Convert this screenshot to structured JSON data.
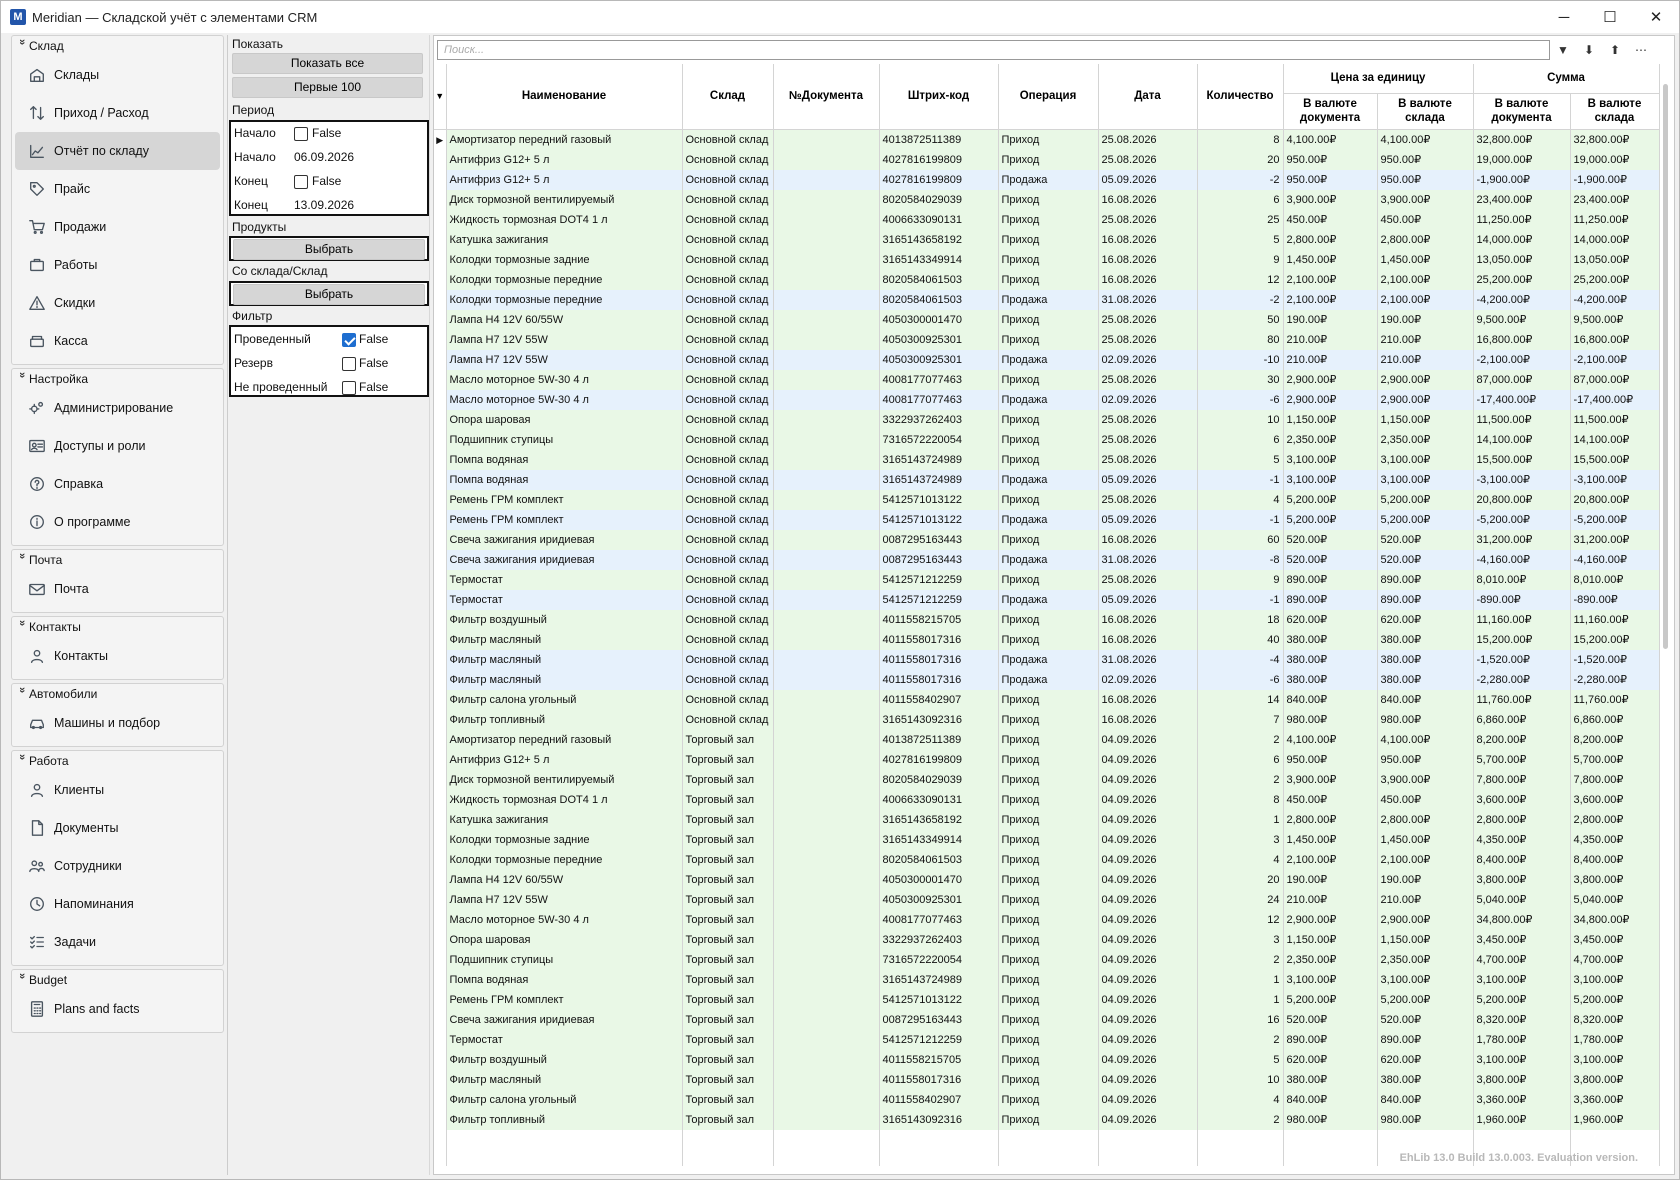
{
  "window": {
    "title": "Meridian — Складской учёт с элементами CRM",
    "logo": "M",
    "minimize": "─",
    "maximize": "☐",
    "close": "✕"
  },
  "sidebar": {
    "groups": [
      {
        "title": "Склад",
        "items": [
          {
            "label": "Склады",
            "icon": "warehouse-icon"
          },
          {
            "label": "Приход / Расход",
            "icon": "in-out-icon"
          },
          {
            "label": "Отчёт по складу",
            "icon": "report-chart-icon",
            "active": true
          },
          {
            "label": "Прайс",
            "icon": "tag-icon"
          },
          {
            "label": "Продажи",
            "icon": "cart-icon"
          },
          {
            "label": "Работы",
            "icon": "briefcase-icon"
          },
          {
            "label": "Скидки",
            "icon": "warning-icon"
          },
          {
            "label": "Касса",
            "icon": "cashbox-icon"
          }
        ]
      },
      {
        "title": "Настройка",
        "items": [
          {
            "label": "Администрирование",
            "icon": "gears-icon"
          },
          {
            "label": "Доступы и роли",
            "icon": "id-card-icon"
          },
          {
            "label": "Справка",
            "icon": "help-icon"
          },
          {
            "label": "О программе",
            "icon": "info-icon"
          }
        ]
      },
      {
        "title": "Почта",
        "items": [
          {
            "label": "Почта",
            "icon": "mail-icon"
          }
        ]
      },
      {
        "title": "Контакты",
        "items": [
          {
            "label": "Контакты",
            "icon": "person-icon"
          }
        ]
      },
      {
        "title": "Автомобили",
        "items": [
          {
            "label": "Машины и подбор",
            "icon": "car-icon"
          }
        ]
      },
      {
        "title": "Работа",
        "items": [
          {
            "label": "Клиенты",
            "icon": "person-icon"
          },
          {
            "label": "Документы",
            "icon": "document-icon"
          },
          {
            "label": "Сотрудники",
            "icon": "people-icon"
          },
          {
            "label": "Напоминания",
            "icon": "clock-icon"
          },
          {
            "label": "Задачи",
            "icon": "checklist-icon"
          }
        ]
      },
      {
        "title": "Budget",
        "items": [
          {
            "label": "Plans and facts",
            "icon": "calculator-icon"
          }
        ]
      }
    ]
  },
  "filter": {
    "show_label": "Показать",
    "show_all": "Показать все",
    "first_100": "Первые 100",
    "period_label": "Период",
    "start1_label": "Начало",
    "start1_value": "False",
    "start2_label": "Начало",
    "start2_value": "06.09.2026",
    "end1_label": "Конец",
    "end1_value": "False",
    "end2_label": "Конец",
    "end2_value": "13.09.2026",
    "products_label": "Продукты",
    "products_btn": "Выбрать",
    "from_wh_label": "Со склада/Склад",
    "from_wh_btn": "Выбрать",
    "filter_label": "Фильтр",
    "posted_label": "Проведенный",
    "posted_value": "False",
    "reserve_label": "Резерв",
    "reserve_value": "False",
    "notposted_label": "Не проведенный",
    "notposted_value": "False"
  },
  "grid": {
    "search_placeholder": "Поиск...",
    "headers": {
      "name": "Наименование",
      "wh": "Склад",
      "doc": "№Документа",
      "barcode": "Штрих-код",
      "op": "Операция",
      "date": "Дата",
      "qty": "Количество",
      "unit_price": "Цена за единицу",
      "sum": "Сумма",
      "doc_cur": "В валюте документа",
      "wh_cur": "В валюте склада"
    },
    "rows": [
      [
        "Амортизатор передний газовый",
        "Основной склад",
        "",
        "4013872511389",
        "Приход",
        "25.08.2026",
        "8",
        "4,100.00₽",
        "4,100.00₽",
        "32,800.00₽",
        "32,800.00₽"
      ],
      [
        "Антифриз G12+ 5 л",
        "Основной склад",
        "",
        "4027816199809",
        "Приход",
        "25.08.2026",
        "20",
        "950.00₽",
        "950.00₽",
        "19,000.00₽",
        "19,000.00₽"
      ],
      [
        "Антифриз G12+ 5 л",
        "Основной склад",
        "",
        "4027816199809",
        "Продажа",
        "05.09.2026",
        "-2",
        "950.00₽",
        "950.00₽",
        "-1,900.00₽",
        "-1,900.00₽"
      ],
      [
        "Диск тормозной вентилируемый",
        "Основной склад",
        "",
        "8020584029039",
        "Приход",
        "16.08.2026",
        "6",
        "3,900.00₽",
        "3,900.00₽",
        "23,400.00₽",
        "23,400.00₽"
      ],
      [
        "Жидкость тормозная DOT4 1 л",
        "Основной склад",
        "",
        "4006633090131",
        "Приход",
        "25.08.2026",
        "25",
        "450.00₽",
        "450.00₽",
        "11,250.00₽",
        "11,250.00₽"
      ],
      [
        "Катушка зажигания",
        "Основной склад",
        "",
        "3165143658192",
        "Приход",
        "16.08.2026",
        "5",
        "2,800.00₽",
        "2,800.00₽",
        "14,000.00₽",
        "14,000.00₽"
      ],
      [
        "Колодки тормозные задние",
        "Основной склад",
        "",
        "3165143349914",
        "Приход",
        "16.08.2026",
        "9",
        "1,450.00₽",
        "1,450.00₽",
        "13,050.00₽",
        "13,050.00₽"
      ],
      [
        "Колодки тормозные передние",
        "Основной склад",
        "",
        "8020584061503",
        "Приход",
        "16.08.2026",
        "12",
        "2,100.00₽",
        "2,100.00₽",
        "25,200.00₽",
        "25,200.00₽"
      ],
      [
        "Колодки тормозные передние",
        "Основной склад",
        "",
        "8020584061503",
        "Продажа",
        "31.08.2026",
        "-2",
        "2,100.00₽",
        "2,100.00₽",
        "-4,200.00₽",
        "-4,200.00₽"
      ],
      [
        "Лампа H4 12V 60/55W",
        "Основной склад",
        "",
        "4050300001470",
        "Приход",
        "25.08.2026",
        "50",
        "190.00₽",
        "190.00₽",
        "9,500.00₽",
        "9,500.00₽"
      ],
      [
        "Лампа H7 12V 55W",
        "Основной склад",
        "",
        "4050300925301",
        "Приход",
        "25.08.2026",
        "80",
        "210.00₽",
        "210.00₽",
        "16,800.00₽",
        "16,800.00₽"
      ],
      [
        "Лампа H7 12V 55W",
        "Основной склад",
        "",
        "4050300925301",
        "Продажа",
        "02.09.2026",
        "-10",
        "210.00₽",
        "210.00₽",
        "-2,100.00₽",
        "-2,100.00₽"
      ],
      [
        "Масло моторное 5W-30 4 л",
        "Основной склад",
        "",
        "4008177077463",
        "Приход",
        "25.08.2026",
        "30",
        "2,900.00₽",
        "2,900.00₽",
        "87,000.00₽",
        "87,000.00₽"
      ],
      [
        "Масло моторное 5W-30 4 л",
        "Основной склад",
        "",
        "4008177077463",
        "Продажа",
        "02.09.2026",
        "-6",
        "2,900.00₽",
        "2,900.00₽",
        "-17,400.00₽",
        "-17,400.00₽"
      ],
      [
        "Опора шаровая",
        "Основной склад",
        "",
        "3322937262403",
        "Приход",
        "25.08.2026",
        "10",
        "1,150.00₽",
        "1,150.00₽",
        "11,500.00₽",
        "11,500.00₽"
      ],
      [
        "Подшипник ступицы",
        "Основной склад",
        "",
        "7316572220054",
        "Приход",
        "25.08.2026",
        "6",
        "2,350.00₽",
        "2,350.00₽",
        "14,100.00₽",
        "14,100.00₽"
      ],
      [
        "Помпа водяная",
        "Основной склад",
        "",
        "3165143724989",
        "Приход",
        "25.08.2026",
        "5",
        "3,100.00₽",
        "3,100.00₽",
        "15,500.00₽",
        "15,500.00₽"
      ],
      [
        "Помпа водяная",
        "Основной склад",
        "",
        "3165143724989",
        "Продажа",
        "05.09.2026",
        "-1",
        "3,100.00₽",
        "3,100.00₽",
        "-3,100.00₽",
        "-3,100.00₽"
      ],
      [
        "Ремень ГРМ комплект",
        "Основной склад",
        "",
        "5412571013122",
        "Приход",
        "25.08.2026",
        "4",
        "5,200.00₽",
        "5,200.00₽",
        "20,800.00₽",
        "20,800.00₽"
      ],
      [
        "Ремень ГРМ комплект",
        "Основной склад",
        "",
        "5412571013122",
        "Продажа",
        "05.09.2026",
        "-1",
        "5,200.00₽",
        "5,200.00₽",
        "-5,200.00₽",
        "-5,200.00₽"
      ],
      [
        "Свеча зажигания иридиевая",
        "Основной склад",
        "",
        "0087295163443",
        "Приход",
        "16.08.2026",
        "60",
        "520.00₽",
        "520.00₽",
        "31,200.00₽",
        "31,200.00₽"
      ],
      [
        "Свеча зажигания иридиевая",
        "Основной склад",
        "",
        "0087295163443",
        "Продажа",
        "31.08.2026",
        "-8",
        "520.00₽",
        "520.00₽",
        "-4,160.00₽",
        "-4,160.00₽"
      ],
      [
        "Термостат",
        "Основной склад",
        "",
        "5412571212259",
        "Приход",
        "25.08.2026",
        "9",
        "890.00₽",
        "890.00₽",
        "8,010.00₽",
        "8,010.00₽"
      ],
      [
        "Термостат",
        "Основной склад",
        "",
        "5412571212259",
        "Продажа",
        "05.09.2026",
        "-1",
        "890.00₽",
        "890.00₽",
        "-890.00₽",
        "-890.00₽"
      ],
      [
        "Фильтр воздушный",
        "Основной склад",
        "",
        "4011558215705",
        "Приход",
        "16.08.2026",
        "18",
        "620.00₽",
        "620.00₽",
        "11,160.00₽",
        "11,160.00₽"
      ],
      [
        "Фильтр масляный",
        "Основной склад",
        "",
        "4011558017316",
        "Приход",
        "16.08.2026",
        "40",
        "380.00₽",
        "380.00₽",
        "15,200.00₽",
        "15,200.00₽"
      ],
      [
        "Фильтр масляный",
        "Основной склад",
        "",
        "4011558017316",
        "Продажа",
        "31.08.2026",
        "-4",
        "380.00₽",
        "380.00₽",
        "-1,520.00₽",
        "-1,520.00₽"
      ],
      [
        "Фильтр масляный",
        "Основной склад",
        "",
        "4011558017316",
        "Продажа",
        "02.09.2026",
        "-6",
        "380.00₽",
        "380.00₽",
        "-2,280.00₽",
        "-2,280.00₽"
      ],
      [
        "Фильтр салона угольный",
        "Основной склад",
        "",
        "4011558402907",
        "Приход",
        "16.08.2026",
        "14",
        "840.00₽",
        "840.00₽",
        "11,760.00₽",
        "11,760.00₽"
      ],
      [
        "Фильтр топливный",
        "Основной склад",
        "",
        "3165143092316",
        "Приход",
        "16.08.2026",
        "7",
        "980.00₽",
        "980.00₽",
        "6,860.00₽",
        "6,860.00₽"
      ],
      [
        "Амортизатор передний газовый",
        "Торговый зал",
        "",
        "4013872511389",
        "Приход",
        "04.09.2026",
        "2",
        "4,100.00₽",
        "4,100.00₽",
        "8,200.00₽",
        "8,200.00₽"
      ],
      [
        "Антифриз G12+ 5 л",
        "Торговый зал",
        "",
        "4027816199809",
        "Приход",
        "04.09.2026",
        "6",
        "950.00₽",
        "950.00₽",
        "5,700.00₽",
        "5,700.00₽"
      ],
      [
        "Диск тормозной вентилируемый",
        "Торговый зал",
        "",
        "8020584029039",
        "Приход",
        "04.09.2026",
        "2",
        "3,900.00₽",
        "3,900.00₽",
        "7,800.00₽",
        "7,800.00₽"
      ],
      [
        "Жидкость тормозная DOT4 1 л",
        "Торговый зал",
        "",
        "4006633090131",
        "Приход",
        "04.09.2026",
        "8",
        "450.00₽",
        "450.00₽",
        "3,600.00₽",
        "3,600.00₽"
      ],
      [
        "Катушка зажигания",
        "Торговый зал",
        "",
        "3165143658192",
        "Приход",
        "04.09.2026",
        "1",
        "2,800.00₽",
        "2,800.00₽",
        "2,800.00₽",
        "2,800.00₽"
      ],
      [
        "Колодки тормозные задние",
        "Торговый зал",
        "",
        "3165143349914",
        "Приход",
        "04.09.2026",
        "3",
        "1,450.00₽",
        "1,450.00₽",
        "4,350.00₽",
        "4,350.00₽"
      ],
      [
        "Колодки тормозные передние",
        "Торговый зал",
        "",
        "8020584061503",
        "Приход",
        "04.09.2026",
        "4",
        "2,100.00₽",
        "2,100.00₽",
        "8,400.00₽",
        "8,400.00₽"
      ],
      [
        "Лампа H4 12V 60/55W",
        "Торговый зал",
        "",
        "4050300001470",
        "Приход",
        "04.09.2026",
        "20",
        "190.00₽",
        "190.00₽",
        "3,800.00₽",
        "3,800.00₽"
      ],
      [
        "Лампа H7 12V 55W",
        "Торговый зал",
        "",
        "4050300925301",
        "Приход",
        "04.09.2026",
        "24",
        "210.00₽",
        "210.00₽",
        "5,040.00₽",
        "5,040.00₽"
      ],
      [
        "Масло моторное 5W-30 4 л",
        "Торговый зал",
        "",
        "4008177077463",
        "Приход",
        "04.09.2026",
        "12",
        "2,900.00₽",
        "2,900.00₽",
        "34,800.00₽",
        "34,800.00₽"
      ],
      [
        "Опора шаровая",
        "Торговый зал",
        "",
        "3322937262403",
        "Приход",
        "04.09.2026",
        "3",
        "1,150.00₽",
        "1,150.00₽",
        "3,450.00₽",
        "3,450.00₽"
      ],
      [
        "Подшипник ступицы",
        "Торговый зал",
        "",
        "7316572220054",
        "Приход",
        "04.09.2026",
        "2",
        "2,350.00₽",
        "2,350.00₽",
        "4,700.00₽",
        "4,700.00₽"
      ],
      [
        "Помпа водяная",
        "Торговый зал",
        "",
        "3165143724989",
        "Приход",
        "04.09.2026",
        "1",
        "3,100.00₽",
        "3,100.00₽",
        "3,100.00₽",
        "3,100.00₽"
      ],
      [
        "Ремень ГРМ комплект",
        "Торговый зал",
        "",
        "5412571013122",
        "Приход",
        "04.09.2026",
        "1",
        "5,200.00₽",
        "5,200.00₽",
        "5,200.00₽",
        "5,200.00₽"
      ],
      [
        "Свеча зажигания иридиевая",
        "Торговый зал",
        "",
        "0087295163443",
        "Приход",
        "04.09.2026",
        "16",
        "520.00₽",
        "520.00₽",
        "8,320.00₽",
        "8,320.00₽"
      ],
      [
        "Термостат",
        "Торговый зал",
        "",
        "5412571212259",
        "Приход",
        "04.09.2026",
        "2",
        "890.00₽",
        "890.00₽",
        "1,780.00₽",
        "1,780.00₽"
      ],
      [
        "Фильтр воздушный",
        "Торговый зал",
        "",
        "4011558215705",
        "Приход",
        "04.09.2026",
        "5",
        "620.00₽",
        "620.00₽",
        "3,100.00₽",
        "3,100.00₽"
      ],
      [
        "Фильтр масляный",
        "Торговый зал",
        "",
        "4011558017316",
        "Приход",
        "04.09.2026",
        "10",
        "380.00₽",
        "380.00₽",
        "3,800.00₽",
        "3,800.00₽"
      ],
      [
        "Фильтр салона угольный",
        "Торговый зал",
        "",
        "4011558402907",
        "Приход",
        "04.09.2026",
        "4",
        "840.00₽",
        "840.00₽",
        "3,360.00₽",
        "3,360.00₽"
      ],
      [
        "Фильтр топливный",
        "Торговый зал",
        "",
        "3165143092316",
        "Приход",
        "04.09.2026",
        "2",
        "980.00₽",
        "980.00₽",
        "1,960.00₽",
        "1,960.00₽"
      ]
    ]
  },
  "watermark": "EhLib 13.0 Build 13.0.003. Evaluation version."
}
